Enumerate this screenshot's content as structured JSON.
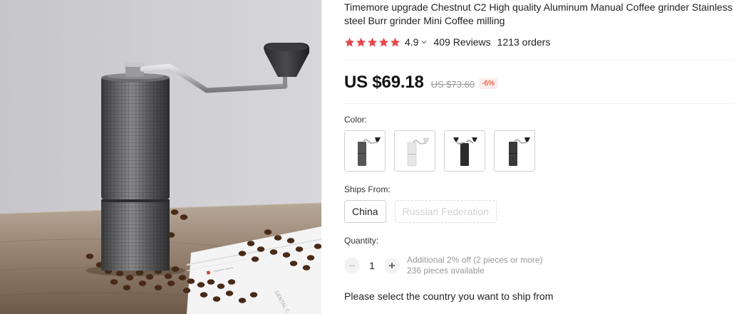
{
  "product": {
    "title": "Timemore upgrade Chestnut C2 High quality Aluminum Manual Coffee grinder Stainless steel Burr grinder Mini Coffee milling",
    "rating": "4.9",
    "reviews": "409 Reviews",
    "orders": "1213 orders",
    "stars_filled": 5
  },
  "price": {
    "current": "US $69.18",
    "original": "US $73.60",
    "discount": "-6%"
  },
  "color": {
    "label": "Color:",
    "options": [
      "dark",
      "white",
      "black",
      "dark-alt"
    ]
  },
  "shipping": {
    "label": "Ships From:",
    "options": [
      "China",
      "Russian Federation"
    ]
  },
  "quantity": {
    "label": "Quantity:",
    "value": "1",
    "note1": "Additional 2% off (2 pieces or more)",
    "note2": "236 pieces available"
  },
  "ship_message": "Please select the country you want to ship from",
  "colors": {
    "star": "#e8474c",
    "discount": "#e62e04",
    "discount_bg": "#fdecec"
  }
}
